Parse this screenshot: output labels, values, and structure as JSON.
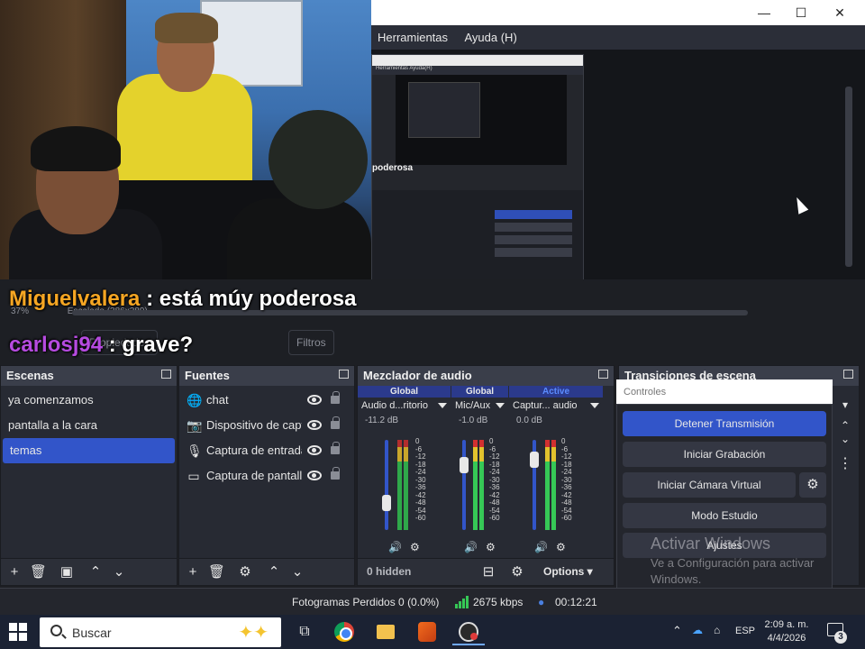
{
  "window": {
    "minimize_glyph": "—",
    "maximize_glyph": "☐",
    "close_glyph": "✕"
  },
  "menu": [
    "Herramientas",
    "Ayuda (H)"
  ],
  "nested_preview": {
    "menu_text": "Herramientas  Ayuda(H)",
    "caption": "poderosa"
  },
  "chat": [
    {
      "user": "Miguelvalera",
      "message": ": está múy poderosa"
    },
    {
      "user": "carlosj94",
      "message": ": grave?"
    }
  ],
  "preview_status": {
    "zoom": "37%",
    "scaling": "Escalado (386x289)"
  },
  "mid_tabs": {
    "filters": "Filtros",
    "properties": "Propiedades"
  },
  "scenes": {
    "title": "Escenas",
    "items": [
      "ya comenzamos",
      "pantalla a la cara",
      "temas"
    ],
    "selected_index": 2
  },
  "sources": {
    "title": "Fuentes",
    "items": [
      {
        "label": "chat",
        "icon": "globe-icon"
      },
      {
        "label": "Dispositivo de capt",
        "icon": "camera-icon"
      },
      {
        "label": "Captura de entrada",
        "icon": "microphone-icon"
      },
      {
        "label": "Captura de pantalla",
        "icon": "monitor-icon"
      }
    ]
  },
  "mixer": {
    "title": "Mezclador de audio",
    "channels": [
      {
        "tag": "Global",
        "name": "Audio d...ritorio",
        "db": "-11.2 dB",
        "level": 0.3
      },
      {
        "tag": "Global",
        "name": "Mic/Aux",
        "db": "-1.0 dB",
        "level": 0.72
      },
      {
        "tag": "Active",
        "name": "Captur... audio",
        "db": "0.0 dB",
        "level": 0.78
      }
    ],
    "scale": [
      "0",
      "-6",
      "-12",
      "-18",
      "-24",
      "-30",
      "-36",
      "-42",
      "-48",
      "-54",
      "-60"
    ],
    "hidden_label": "0 hidden",
    "options_label": "Options"
  },
  "transitions": {
    "title": "Transiciones de escena"
  },
  "controls": {
    "title": "Controles",
    "buttons": [
      "Detener Transmisión",
      "Iniciar Grabación",
      "Iniciar Cámara Virtual",
      "Modo Estudio",
      "Ajustes"
    ]
  },
  "activation": {
    "title": "Activar Windows",
    "subtitle": "Ve a Configuración para activar Windows."
  },
  "status": {
    "dropped_frames": "Fotogramas Perdidos 0 (0.0%)",
    "bitrate": "2675 kbps",
    "stream_time": "00:12:21"
  },
  "taskbar": {
    "search_placeholder": "Buscar",
    "language": "ESP",
    "time": "2:09 a. m.",
    "date": "4/4/2026",
    "notification_count": "3"
  },
  "colors": {
    "accent": "#3255c9",
    "chat_user_1": "#f6a623",
    "chat_user_2": "#b64be0",
    "meter_green": "#36c856"
  }
}
